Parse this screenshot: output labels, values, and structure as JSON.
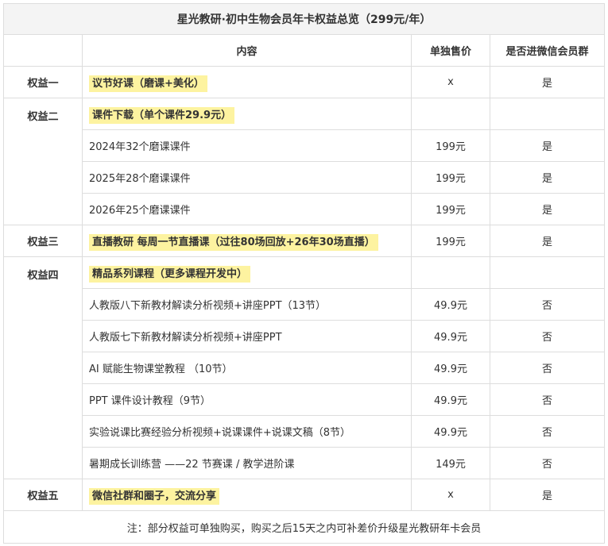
{
  "title": "星光教研·初中生物会员年卡权益总览（299元/年）",
  "headers": [
    "",
    "内容",
    "单独售价",
    "是否进微信会员群"
  ],
  "sections": [
    {
      "label": "权益一",
      "heading": "议节好课（磨课+美化）",
      "price": "x",
      "group": "是",
      "rows": []
    },
    {
      "label": "权益二",
      "heading": "课件下载（单个课件29.9元）",
      "price": "",
      "group": "",
      "rows": [
        {
          "content": "2024年32个磨课课件",
          "price": "199元",
          "group": "是"
        },
        {
          "content": "2025年28个磨课课件",
          "price": "199元",
          "group": "是"
        },
        {
          "content": "2026年25个磨课课件",
          "price": "199元",
          "group": "是"
        }
      ]
    },
    {
      "label": "权益三",
      "heading": "直播教研 每周一节直播课（过往80场回放+26年30场直播）",
      "price": "199元",
      "group": "是",
      "rows": []
    },
    {
      "label": "权益四",
      "heading": "精品系列课程（更多课程开发中）",
      "price": "",
      "group": "",
      "rows": [
        {
          "content": "人教版八下新教材解读分析视频+讲座PPT（13节）",
          "price": "49.9元",
          "group": "否"
        },
        {
          "content": "人教版七下新教材解读分析视频+讲座PPT",
          "price": "49.9元",
          "group": "否"
        },
        {
          "content": "AI 赋能生物课堂教程 （10节）",
          "price": "49.9元",
          "group": "否"
        },
        {
          "content": "PPT 课件设计教程（9节）",
          "price": "49.9元",
          "group": "否"
        },
        {
          "content": "实验说课比赛经验分析视频+说课课件+说课文稿（8节）",
          "price": "49.9元",
          "group": "否"
        },
        {
          "content": "暑期成长训练营 ——22 节赛课 / 教学进阶课",
          "price": "149元",
          "group": "否"
        }
      ]
    },
    {
      "label": "权益五",
      "heading": "微信社群和圈子，交流分享",
      "price": "x",
      "group": "是",
      "rows": []
    }
  ],
  "note": "注：部分权益可单独购买，购买之后15天之内可补差价升级星光教研年卡会员",
  "colors": {
    "highlight": "#fdf3a0",
    "title_bg": "#f4f4f4",
    "border": "#dddddd"
  }
}
